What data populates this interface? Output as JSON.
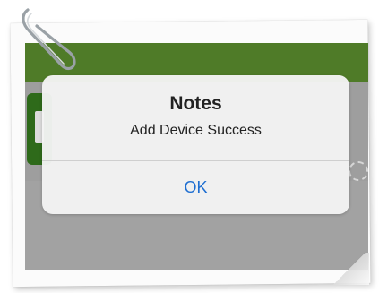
{
  "alert": {
    "title": "Notes",
    "message": "Add Device Success",
    "button_label": "OK"
  },
  "colors": {
    "header_green": "#4f7b28",
    "alert_button_blue": "#1f6fd1"
  },
  "icons": {
    "paperclip": "paperclip-icon",
    "device": "device-icon",
    "loading": "spinner-icon"
  }
}
